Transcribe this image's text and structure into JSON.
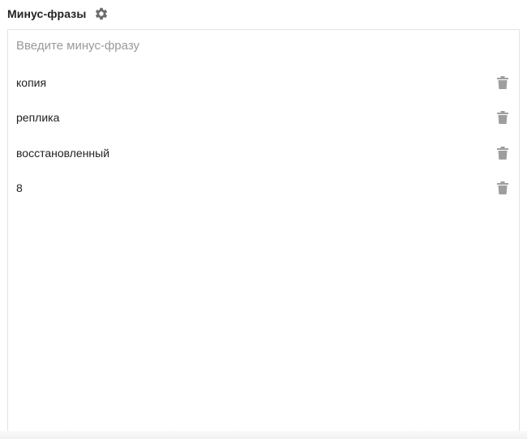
{
  "header": {
    "title": "Минус-фразы",
    "settings_icon": "gear-icon"
  },
  "input": {
    "placeholder": "Введите минус-фразу",
    "value": ""
  },
  "phrases": [
    {
      "label": "копия",
      "icon": "trash-icon"
    },
    {
      "label": "реплика",
      "icon": "trash-icon"
    },
    {
      "label": "восстановленный",
      "icon": "trash-icon"
    },
    {
      "label": "8",
      "icon": "trash-icon"
    }
  ],
  "colors": {
    "icon": "#9e9e9e",
    "gear": "#6d6d6d",
    "border": "#e3e3e3",
    "placeholder": "#9a9a9a"
  }
}
